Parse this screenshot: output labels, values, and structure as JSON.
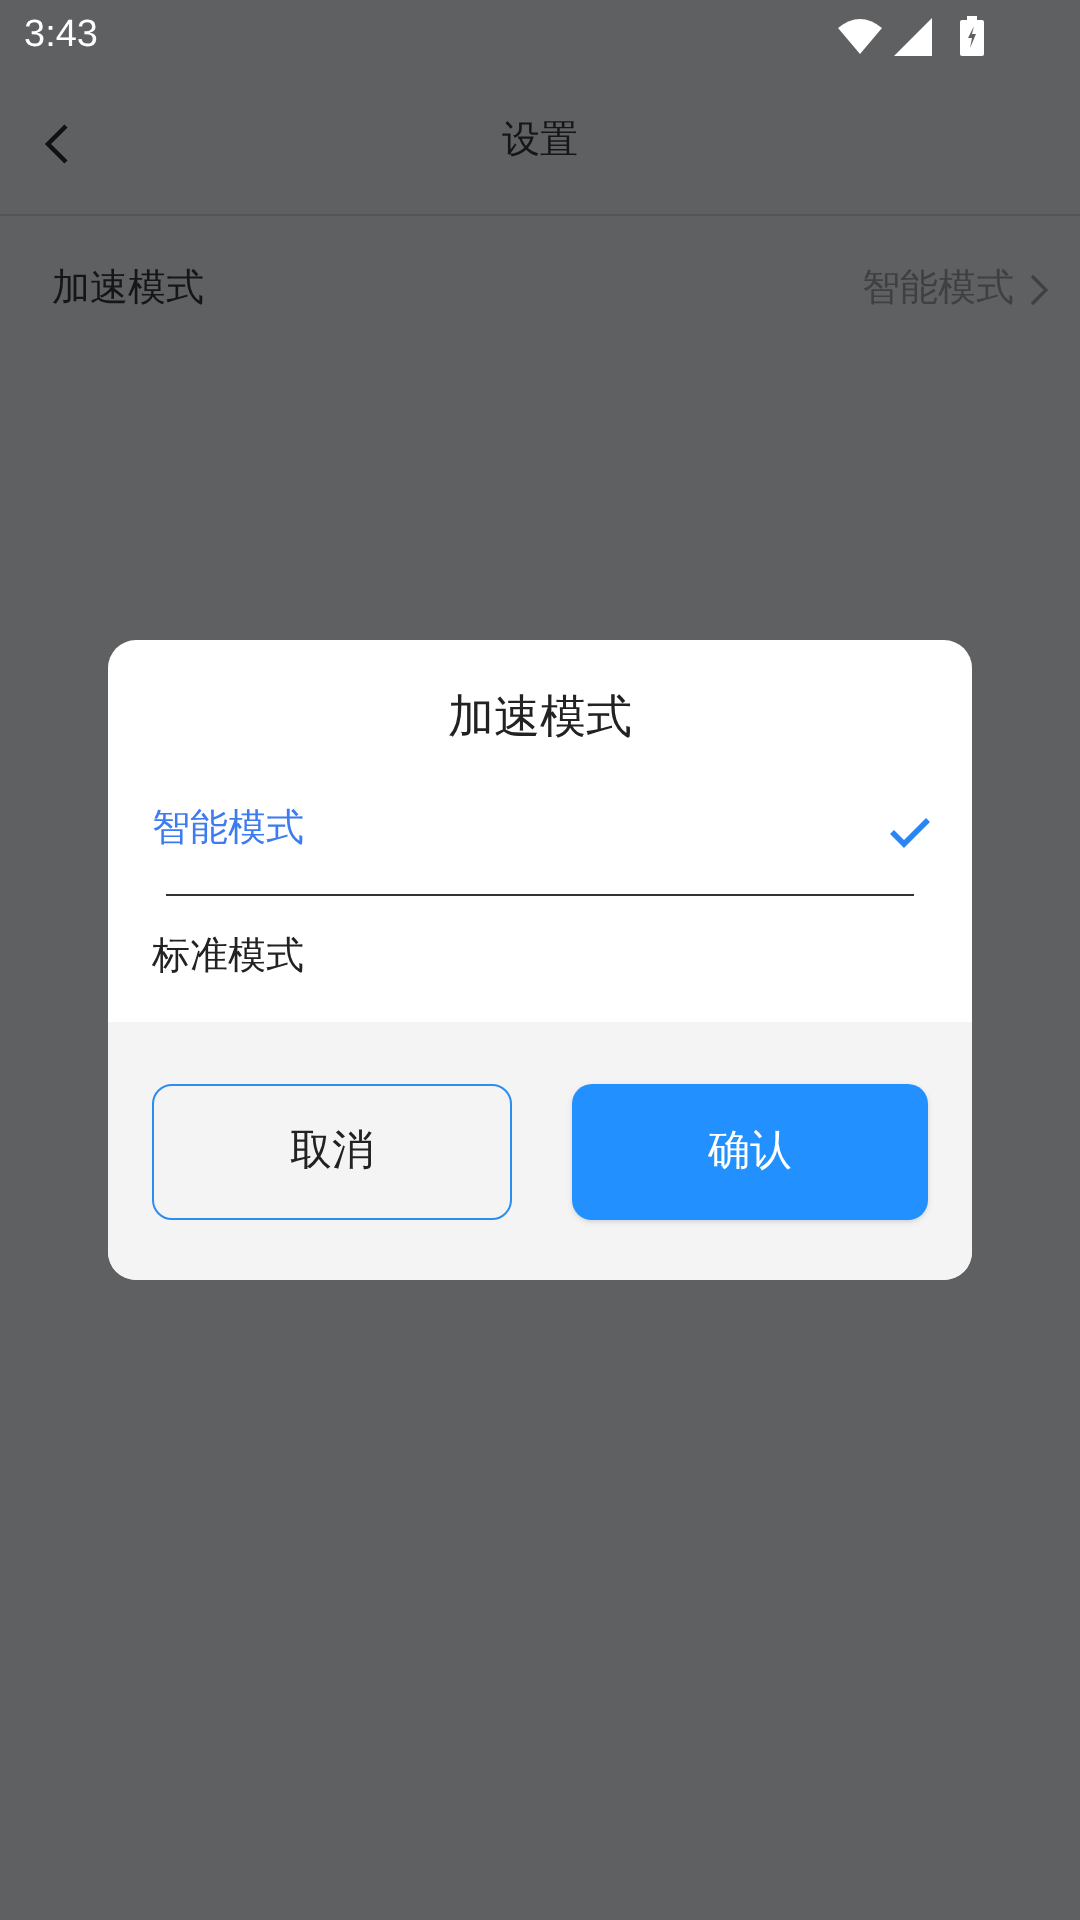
{
  "status_bar": {
    "time": "3:43"
  },
  "header": {
    "title": "设置"
  },
  "settings": [
    {
      "label": "加速模式",
      "value": "智能模式"
    }
  ],
  "dialog": {
    "title": "加速模式",
    "options": [
      {
        "label": "智能模式",
        "selected": true
      },
      {
        "label": "标准模式",
        "selected": false
      }
    ],
    "buttons": [
      {
        "label": "取消",
        "kind": "secondary"
      },
      {
        "label": "确认",
        "kind": "primary"
      }
    ]
  }
}
